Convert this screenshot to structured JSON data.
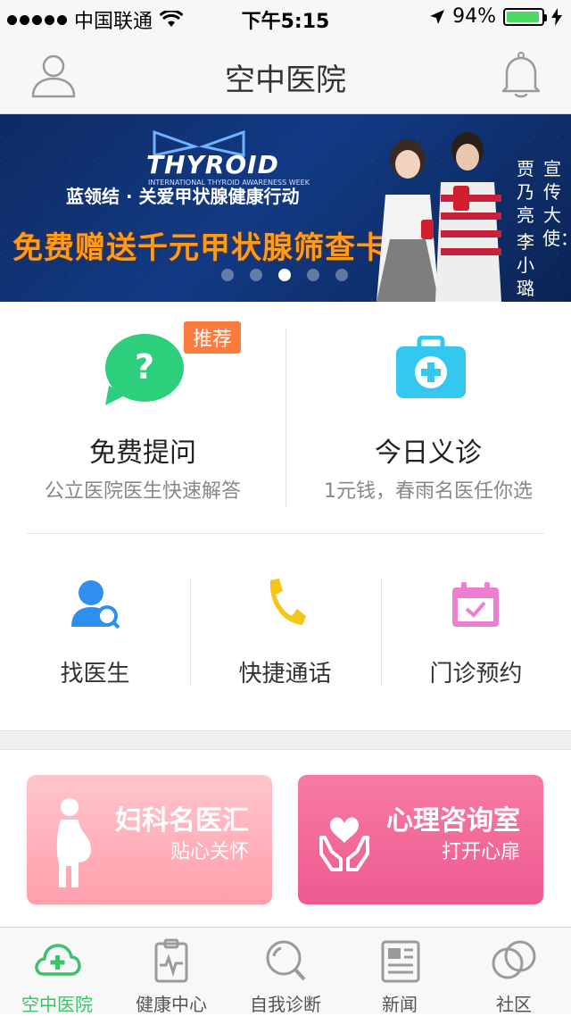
{
  "status_bar": {
    "carrier": "中国联通",
    "time": "下午5:15",
    "battery_percent": "94%",
    "battery_level": 0.94
  },
  "nav": {
    "title": "空中医院",
    "left_icon": "user-icon",
    "right_icon": "bell-icon"
  },
  "banner": {
    "logo_word": "THYROID",
    "logo_sub": "INTERNATIONAL THYROID AWARENESS WEEK",
    "slogan1": "蓝领结 · 关爱甲状腺健康行动",
    "slogan2": "免费赠送千元甲状腺筛查卡",
    "ambassador_label": "宣传大使：",
    "ambassador_1": "贾乃亮",
    "ambassador_2": "李小璐",
    "slide_count": 5,
    "active_slide": 3
  },
  "features": [
    {
      "title": "免费提问",
      "subtitle": "公立医院医生快速解答",
      "badge": "推荐",
      "icon": "question-bubble-icon",
      "color": "#2ecf7c"
    },
    {
      "title": "今日义诊",
      "subtitle": "1元钱，春雨名医任你选",
      "icon": "medical-kit-icon",
      "color": "#34c8f0"
    }
  ],
  "tools": [
    {
      "label": "找医生",
      "icon": "find-doctor-icon",
      "color": "#2e8ff0"
    },
    {
      "label": "快捷通话",
      "icon": "phone-icon",
      "color": "#f5c518"
    },
    {
      "label": "门诊预约",
      "icon": "calendar-check-icon",
      "color": "#ee7fd0"
    }
  ],
  "promos": [
    {
      "title": "妇科名医汇",
      "subtitle": "贴心关怀",
      "icon": "pregnant-woman-icon",
      "color_from": "#ffc5cc",
      "color_to": "#ff9fac"
    },
    {
      "title": "心理咨询室",
      "subtitle": "打开心扉",
      "icon": "heart-hands-icon",
      "color_from": "#f77aa6",
      "color_to": "#ee5a8f"
    }
  ],
  "tabs": [
    {
      "label": "空中医院",
      "icon": "cloud-plus-icon",
      "active": true
    },
    {
      "label": "健康中心",
      "icon": "clipboard-pulse-icon",
      "active": false
    },
    {
      "label": "自我诊断",
      "icon": "magnifier-icon",
      "active": false
    },
    {
      "label": "新闻",
      "icon": "newspaper-icon",
      "active": false
    },
    {
      "label": "社区",
      "icon": "community-circles-icon",
      "active": false
    }
  ],
  "colors": {
    "accent_green": "#3cc36a",
    "badge_orange": "#ff7a3d",
    "banner_orange": "#ff9a1a"
  }
}
